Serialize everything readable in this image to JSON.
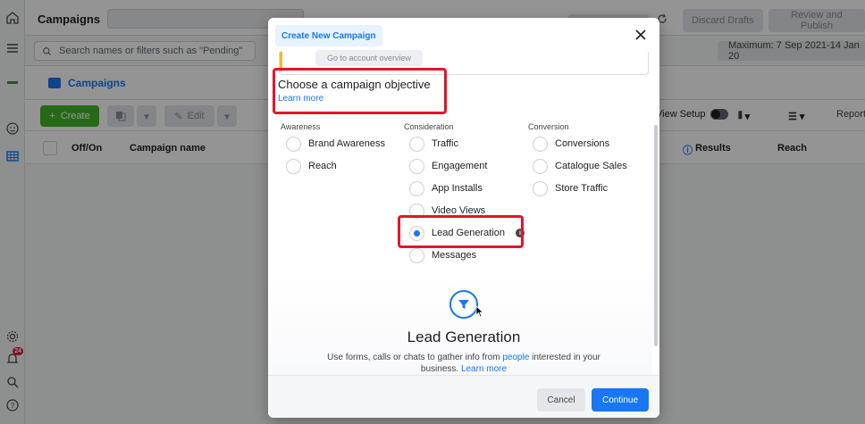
{
  "topbar": {
    "title": "Campaigns",
    "discard_label": "Discard Drafts",
    "review_label": "Review and Publish"
  },
  "search": {
    "placeholder": "Search names or filters such as \"Pending\"",
    "date_range": "Maximum: 7 Sep 2021-14 Jan 20"
  },
  "tabs": {
    "campaigns_label": "Campaigns"
  },
  "toolbar": {
    "create_label": "Create",
    "edit_label": "Edit",
    "view_setup_label": "View Setup",
    "report_label": "Report"
  },
  "table": {
    "columns": {
      "offon": "Off/On",
      "campaign_name": "Campaign name",
      "results": "Results",
      "reach": "Reach"
    }
  },
  "rail": {
    "notification_count": "24"
  },
  "modal": {
    "tag": "Create New Campaign",
    "peek_button": "Go to account overview",
    "title": "Choose a campaign objective",
    "learn_more": "Learn more",
    "columns": [
      {
        "heading": "Awareness",
        "options": [
          "Brand Awareness",
          "Reach"
        ]
      },
      {
        "heading": "Consideration",
        "options": [
          "Traffic",
          "Engagement",
          "App Installs",
          "Video Views",
          "Lead Generation",
          "Messages"
        ]
      },
      {
        "heading": "Conversion",
        "options": [
          "Conversions",
          "Catalogue Sales",
          "Store Traffic"
        ]
      }
    ],
    "selected": "Lead Generation",
    "detail": {
      "title": "Lead Generation",
      "text_before": "Use forms, calls or chats to gather info from ",
      "text_link1": "people",
      "text_after": " interested in your business. ",
      "text_link2": "Learn more"
    },
    "cancel_label": "Cancel",
    "continue_label": "Continue"
  },
  "colors": {
    "accent": "#1877f2",
    "create_green": "#42b72a",
    "highlight_red": "#e3152b"
  }
}
